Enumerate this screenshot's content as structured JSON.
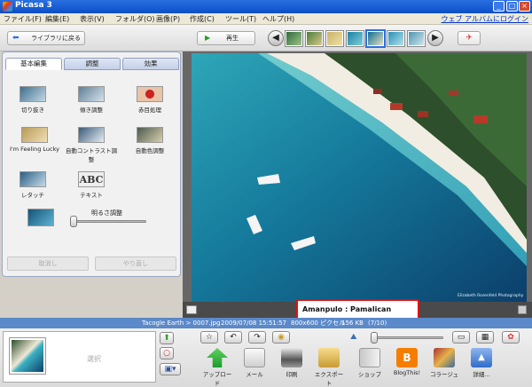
{
  "window": {
    "title": "Picasa 3",
    "minimize": "_",
    "maximize": "□",
    "close": "×"
  },
  "menu": {
    "items": [
      "ファイル(F)",
      "編集(E)",
      "表示(V)",
      "フォルダ(O)",
      "画像(P)",
      "作成(C)",
      "ツール(T)",
      "ヘルプ(H)"
    ],
    "web_login": "ウェブ アルバムにログイン"
  },
  "toolbar": {
    "back_label": "ライブラリに戻る",
    "play_label": "再生",
    "prev_symbol": "◀",
    "next_symbol": "▶"
  },
  "left_panel": {
    "tabs": [
      "基本編集",
      "調整",
      "効果"
    ],
    "tools": [
      "切り抜き",
      "傾き調整",
      "赤目処理",
      "I'm Feeling Lucky",
      "自動コントラスト調整",
      "自動色調整",
      "レタッチ",
      "テキスト"
    ],
    "text_icon": "ABC",
    "brightness_label": "明るさ調整",
    "undo_label": "取消し",
    "redo_label": "やり直し"
  },
  "viewer": {
    "caption": "Amanpulo : Pamalican Island :|",
    "photo_credit": "Elizabeth Rosenfeld Photography"
  },
  "status": {
    "path": "Tacogle Earth > 0007.jpg",
    "date": "2009/07/08 15:51:57",
    "dimensions": "800x600 ピクセル",
    "size": "156 KB",
    "index": "(7/10)"
  },
  "bottom": {
    "select_label": "選択",
    "buttons": [
      "アップロード",
      "メール",
      "印刷",
      "エクスポート",
      "ショップ",
      "BlogThis!",
      "コラージュ",
      "詳細..."
    ]
  },
  "colors": {
    "accent": "#2a6fe0",
    "status_bar": "#5b89c9",
    "caption_border": "#e01010"
  }
}
